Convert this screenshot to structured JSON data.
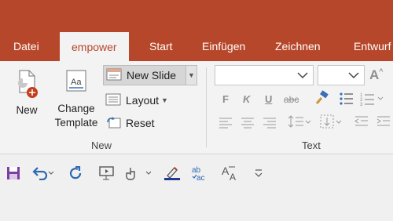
{
  "tabs": [
    {
      "label": "Datei"
    },
    {
      "label": "empower"
    },
    {
      "label": "Start"
    },
    {
      "label": "Einfügen"
    },
    {
      "label": "Zeichnen"
    },
    {
      "label": "Entwurf"
    }
  ],
  "ribbon": {
    "new_group": {
      "label": "New",
      "new_button": "New",
      "change_template_line1": "Change",
      "change_template_line2": "Template",
      "new_slide": "New Slide",
      "layout": "Layout",
      "reset": "Reset"
    },
    "text_group": {
      "label": "Text",
      "bold": "F",
      "italic": "K",
      "underline": "U",
      "strike": "abc"
    }
  },
  "colors": {
    "brand": "#b7472a",
    "ribbon_bg": "#f3f3f3"
  }
}
